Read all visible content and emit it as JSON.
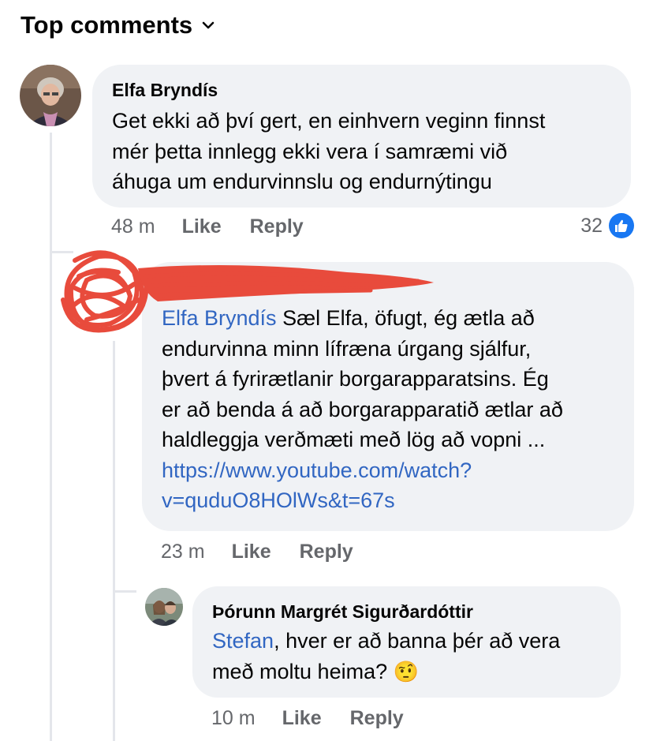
{
  "header": {
    "sort_label": "Top comments",
    "sort_icon": "chevron-down-icon"
  },
  "comments": [
    {
      "author": "Elfa Bryndís",
      "lines": [
        "Get ekki að því gert,  en einhvern veginn finnst",
        "mér þetta innlegg ekki vera í samræmi við",
        "áhuga um endurvinnslu og endurnýtingu"
      ],
      "time": "48 m",
      "like": "Like",
      "reply": "Reply",
      "reaction_count": "32",
      "reaction_icon": "like-reaction-icon"
    },
    {
      "author": "",
      "mention": "Elfa Bryndís",
      "line1_rest": " Sæl Elfa, öfugt, ég ætla að",
      "lines": [
        "endurvinna minn lífræna úrgang sjálfur,",
        "þvert á fyrirætlanir borgarapparatsins. Ég",
        "er að benda á að borgarapparatið ætlar að",
        "haldleggja verðmæti með lög að vopni ..."
      ],
      "link_lines": [
        "https://www.youtube.com/watch?",
        "v=quduO8HOlWs&t=67s"
      ],
      "time": "23 m",
      "like": "Like",
      "reply": "Reply",
      "redaction_color": "#e84b3c"
    },
    {
      "author": "Þórunn Margrét Sigurðardóttir",
      "mention": "Stefan",
      "line1_rest": ", hver er að banna þér að vera",
      "line2": "með moltu heima? ",
      "emoji": "🤨",
      "emoji_icon": "raised-eyebrow-emoji-icon",
      "time": "10 m",
      "like": "Like",
      "reply": "Reply"
    }
  ]
}
